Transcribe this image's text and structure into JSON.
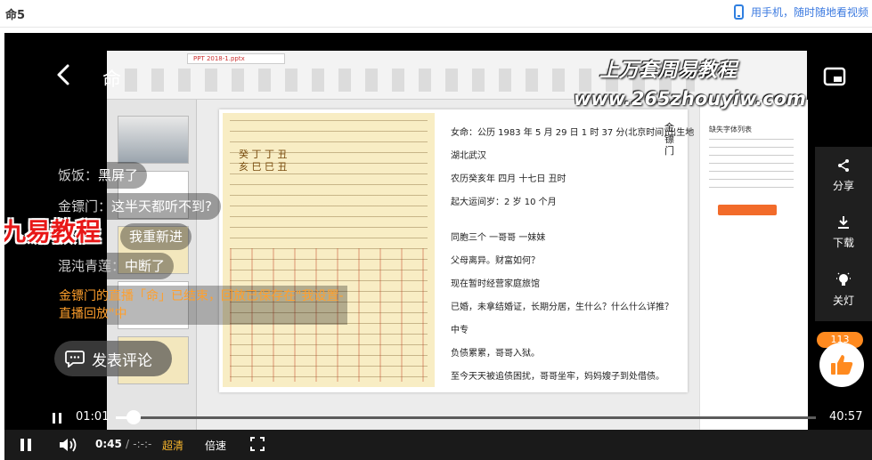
{
  "header": {
    "title": "命5",
    "mobile_promo": "用手机，随时随地看视频"
  },
  "video": {
    "title": "命",
    "watermark_line1": "上万套周易教程",
    "watermark_line2": "www.265zhouyiw.com",
    "brand_overlay": "九易教程",
    "ribbon_tab": "PPT 2018-1.pptx",
    "slide": {
      "vertical_title": "金镖门",
      "lines": [
        "女命：公历 1983 年 5 月 29 日 1 时 37 分(北京时间)出生地",
        "湖北武汉",
        "农历癸亥年 四月 十七日 丑时",
        "起大运间岁：2 岁 10 个月",
        "同胞三个 一哥哥 一妹妹",
        "父母离异。财富如何？",
        "现在暂时经营家庭旅馆",
        "已婚，未拿结婚证，长期分居，生什么？什么什么详推？",
        "中专",
        "负债累累，哥哥入狱。",
        "至今天天被追债困扰，哥哥坐牢，妈妈嫂子到处借债。"
      ],
      "chart_chars": [
        "癸  丁  丁  丑",
        "亥  巳  巳  丑"
      ]
    },
    "right_panel_title": "缺失字体列表"
  },
  "chat": [
    {
      "name": "饭饭：",
      "message": "黑屏了"
    },
    {
      "name": "金镖门：",
      "message": "这半天都听不到?"
    },
    {
      "name": "",
      "message": "我重新进"
    },
    {
      "name": "混沌青莲：",
      "message": "中断了"
    }
  ],
  "system_message": "金镖门的直播「命」已结束，回放已保存在\"我设置-直播回放\"中",
  "comment_button": "发表评论",
  "side_actions": {
    "share": "分享",
    "download": "下载",
    "lights_off": "关灯"
  },
  "likes": {
    "count": "113"
  },
  "progress": {
    "current": "01:01",
    "total": "40:57",
    "fraction": 0.025
  },
  "controls": {
    "time_current": "0:45",
    "time_separator": "/",
    "time_total": "-:-:-",
    "quality": "超清",
    "speed": "倍速"
  }
}
